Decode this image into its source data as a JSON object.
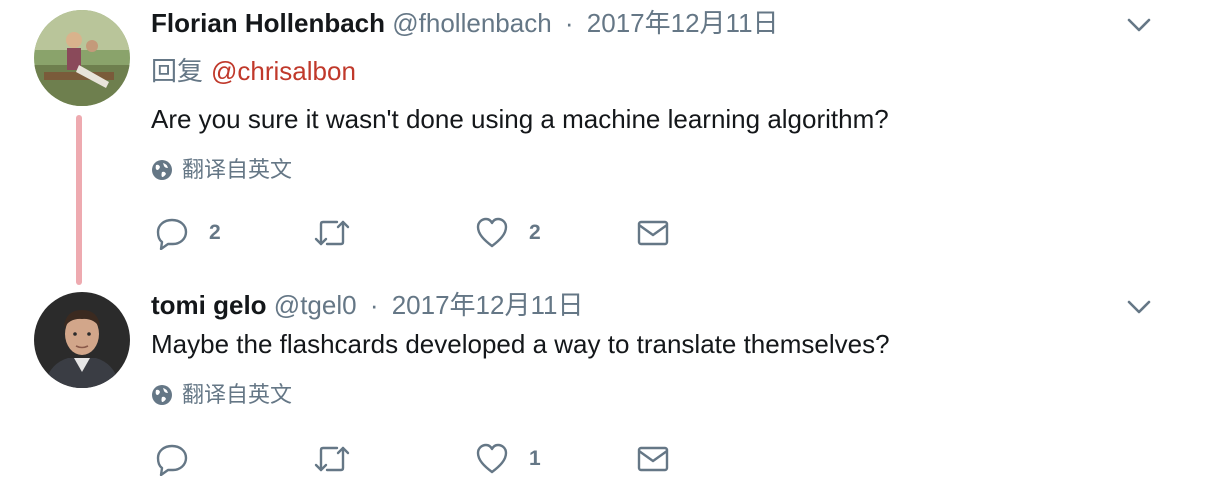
{
  "tweets": [
    {
      "fullname": "Florian Hollenbach",
      "username": "@fhollenbach",
      "separator": "·",
      "time": "2017年12月11日",
      "reply_prefix": "回复",
      "reply_mention": "@chrisalbon",
      "text": "Are you sure it wasn't done using a machine learning algorithm?",
      "translate": "翻译自英文",
      "replies": "2",
      "retweets": "",
      "likes": "2"
    },
    {
      "fullname": "tomi gelo",
      "username": "@tgel0",
      "separator": "·",
      "time": "2017年12月11日",
      "text": "Maybe the flashcards developed a way to translate themselves?",
      "translate": "翻译自英文",
      "replies": "",
      "retweets": "",
      "likes": "1"
    }
  ],
  "colors": {
    "secondary_text": "#657786",
    "mention": "#c0392b",
    "thread_line": "#eeaab0",
    "icon": "#657786"
  },
  "icons": [
    "globe-icon",
    "reply-icon",
    "retweet-icon",
    "like-icon",
    "direct-message-icon",
    "chevron-down-icon"
  ]
}
